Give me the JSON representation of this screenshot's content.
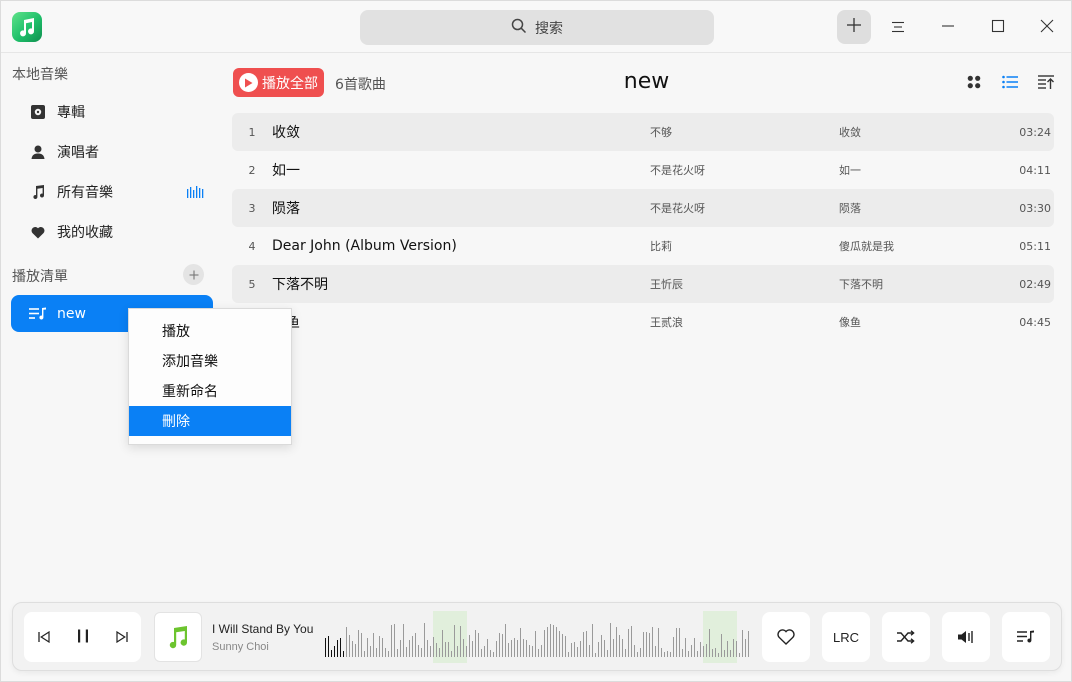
{
  "titlebar": {
    "search_placeholder": "搜索"
  },
  "sidebar": {
    "local_title": "本地音樂",
    "items": [
      {
        "label": "專輯",
        "icon": "album-icon"
      },
      {
        "label": "演唱者",
        "icon": "person-icon"
      },
      {
        "label": "所有音樂",
        "icon": "music-note-icon"
      },
      {
        "label": "我的收藏",
        "icon": "heart-icon"
      }
    ],
    "playlist_title": "播放清單",
    "playlists": [
      {
        "label": "new"
      }
    ]
  },
  "main": {
    "play_all_label": "播放全部",
    "song_count": "6首歌曲",
    "playlist_title": "new",
    "songs": [
      {
        "index": "1",
        "title": "收敛",
        "artist": "不够",
        "album": "收敛",
        "duration": "03:24"
      },
      {
        "index": "2",
        "title": "如一",
        "artist": "不是花火呀",
        "album": "如一",
        "duration": "04:11"
      },
      {
        "index": "3",
        "title": "陨落",
        "artist": "不是花火呀",
        "album": "陨落",
        "duration": "03:30"
      },
      {
        "index": "4",
        "title": "Dear John (Album Version)",
        "artist": "比莉",
        "album": "傻瓜就是我",
        "duration": "05:11"
      },
      {
        "index": "5",
        "title": "下落不明",
        "artist": "王忻辰",
        "album": "下落不明",
        "duration": "02:49"
      },
      {
        "index": "6",
        "title": "像鱼",
        "artist": "王贰浪",
        "album": "像鱼",
        "duration": "04:45"
      }
    ]
  },
  "context_menu": {
    "items": [
      "播放",
      "添加音樂",
      "重新命名",
      "刪除"
    ],
    "active_index": 3
  },
  "player": {
    "song_title": "I Will Stand By You",
    "song_artist": "Sunny Choi",
    "lrc_label": "LRC"
  },
  "colors": {
    "accent": "#0a80f5",
    "play_all": "#ef4f4f",
    "cover_note": "#6cc42e"
  }
}
